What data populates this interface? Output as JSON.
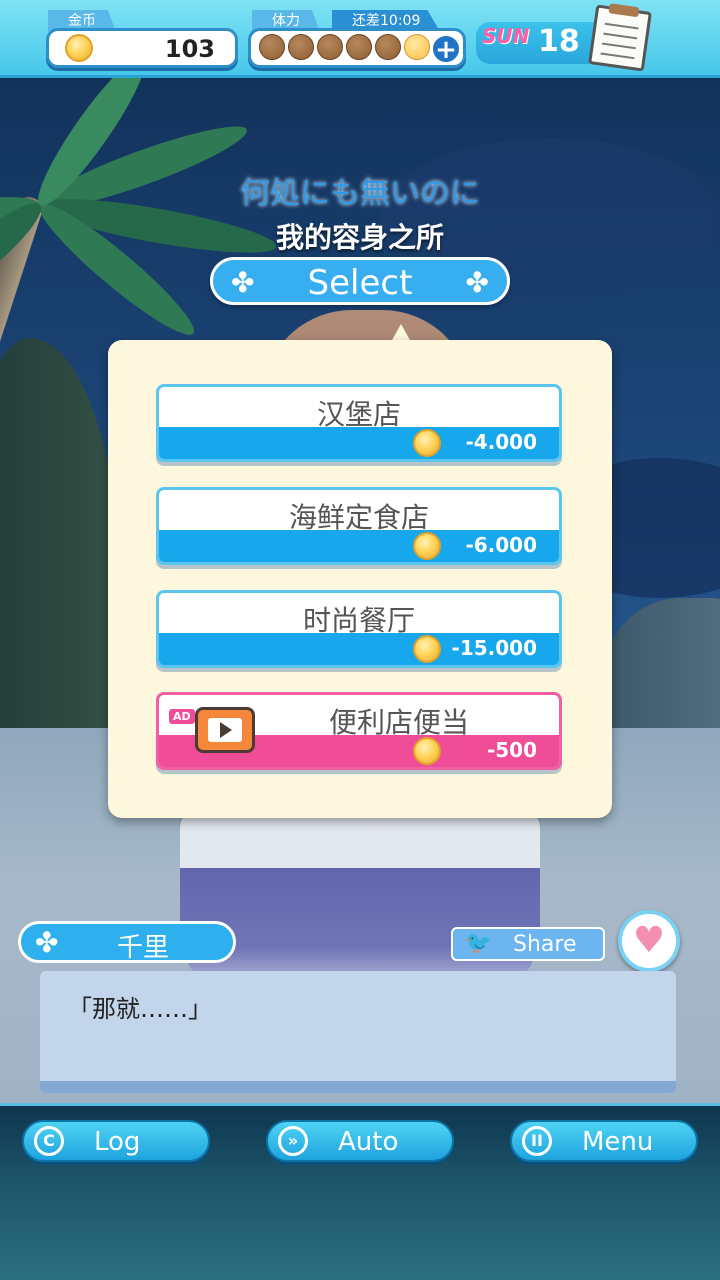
{
  "hud": {
    "gold_label": "金币",
    "gold_value": "103",
    "stamina_label": "体力",
    "stamina_timer": "还差10:09",
    "stamina_current": 1,
    "stamina_max": 6,
    "day_name": "SUN",
    "day_number": "18"
  },
  "lyrics": {
    "line1": "何処にも無いのに",
    "line2": "我的容身之所"
  },
  "select": {
    "title": "Select",
    "options": [
      {
        "label": "汉堡店",
        "price": "-4.000",
        "type": "normal"
      },
      {
        "label": "海鲜定食店",
        "price": "-6.000",
        "type": "normal"
      },
      {
        "label": "时尚餐厅",
        "price": "-15.000",
        "type": "normal"
      },
      {
        "label": "便利店便当",
        "price": "-500",
        "type": "ad",
        "badge": "AD"
      }
    ]
  },
  "dialogue": {
    "speaker": "千里",
    "text": "「那就……」",
    "share_label": "Share"
  },
  "controls": {
    "log_label": "Log",
    "auto_label": "Auto",
    "menu_label": "Menu"
  },
  "colors": {
    "accent": "#17a7ec",
    "ad_accent": "#f04d99",
    "panel": "#fdf7dd"
  }
}
